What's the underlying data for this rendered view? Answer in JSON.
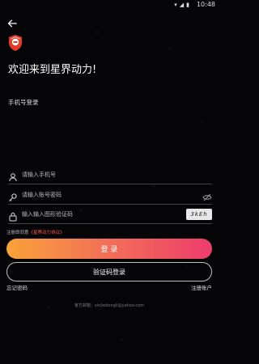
{
  "status_bar": {
    "time": "10:48"
  },
  "header": {
    "welcome": "欢迎来到星界动力!",
    "subtitle": "手机号登录"
  },
  "form": {
    "phone_placeholder": "请输入手机号",
    "password_placeholder": "请输入账号密码",
    "captcha_placeholder": "输入输入图形验证码",
    "captcha_text": "3kEh"
  },
  "agreement": {
    "prefix": "注册即同意",
    "link": "《星界动力协议》"
  },
  "buttons": {
    "login": "登 录",
    "code_login": "验证码登录"
  },
  "links": {
    "forgot": "忘记密码",
    "register": "注册账户"
  },
  "footer": {
    "contact": "官方邮箱：xinjiedongli@yahoo.com"
  },
  "colors": {
    "accent_gradient_start": "#f8a23a",
    "accent_gradient_end": "#ee3d6c",
    "link": "#ff5a4a",
    "logo": "#e53a2a"
  }
}
